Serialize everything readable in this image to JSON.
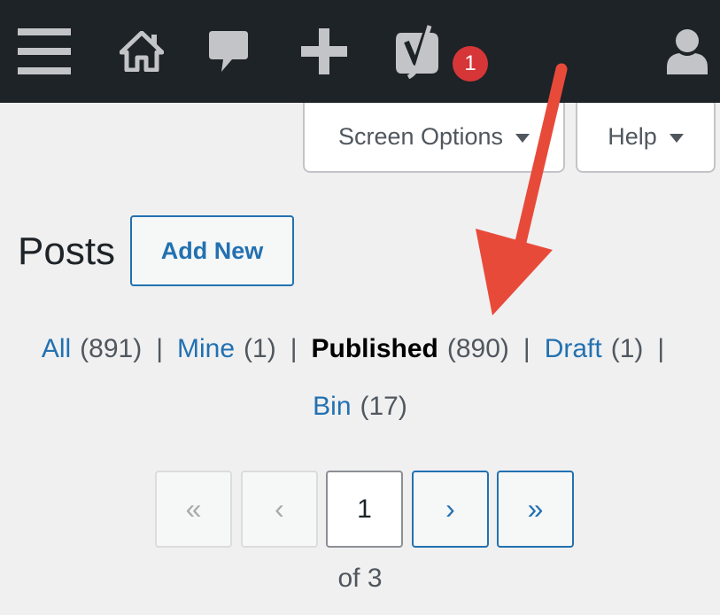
{
  "adminbar": {
    "items": [
      {
        "name": "menu",
        "icon": "hamburger-menu-icon"
      },
      {
        "name": "home",
        "icon": "home-icon"
      },
      {
        "name": "comments",
        "icon": "comment-bubble-icon"
      },
      {
        "name": "new",
        "icon": "plus-icon"
      },
      {
        "name": "yoast",
        "icon": "yoast-icon",
        "badge": "1"
      },
      {
        "name": "account",
        "icon": "user-icon"
      }
    ],
    "background": "#1d2327",
    "badge_color": "#d63638"
  },
  "screen_meta": {
    "screen_options_label": "Screen Options",
    "help_label": "Help"
  },
  "page": {
    "title": "Posts",
    "add_new_label": "Add New"
  },
  "filters": [
    {
      "label": "All",
      "count": "(891)"
    },
    {
      "label": "Mine",
      "count": "(1)"
    },
    {
      "label": "Published",
      "count": "(890)",
      "current": true
    },
    {
      "label": "Draft",
      "count": "(1)"
    },
    {
      "label": "Bin",
      "count": "(17)"
    }
  ],
  "separator": "|",
  "pagination": {
    "first": "«",
    "prev": "‹",
    "current": "1",
    "next": "›",
    "last": "»",
    "of_total": "of 3"
  },
  "annotation": {
    "arrow_color": "#e84a3a",
    "points_to": "Published filter"
  }
}
